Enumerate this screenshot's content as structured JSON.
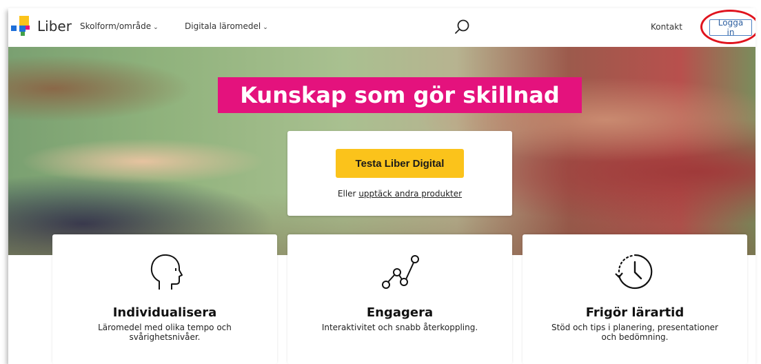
{
  "header": {
    "logo_text": "Liber",
    "nav": [
      {
        "label": "Skolform/område"
      },
      {
        "label": "Digitala läromedel"
      }
    ],
    "contact_label": "Kontakt",
    "login_label": "Logga in"
  },
  "hero": {
    "headline": "Kunskap som gör skillnad",
    "cta_button": "Testa Liber Digital",
    "cta_prefix": "Eller",
    "cta_link": "upptäck andra produkter"
  },
  "features": [
    {
      "title": "Individualisera",
      "desc_line1": "Läromedel med olika tempo och",
      "desc_line2": "svårighetsnivåer.",
      "icon": "head-profile-icon"
    },
    {
      "title": "Engagera",
      "desc_line1": "Interaktivitet och snabb återkoppling.",
      "desc_line2": "",
      "icon": "graph-line-icon"
    },
    {
      "title": "Frigör lärartid",
      "desc_line1": "Stöd och tips i planering, presentationer",
      "desc_line2": "och bedömning.",
      "icon": "clock-icon"
    }
  ],
  "colors": {
    "headline_bg": "#e4127d",
    "cta_button": "#fbc31b",
    "login_border": "#4a7fc1",
    "annotation_circle": "#e0141e"
  }
}
